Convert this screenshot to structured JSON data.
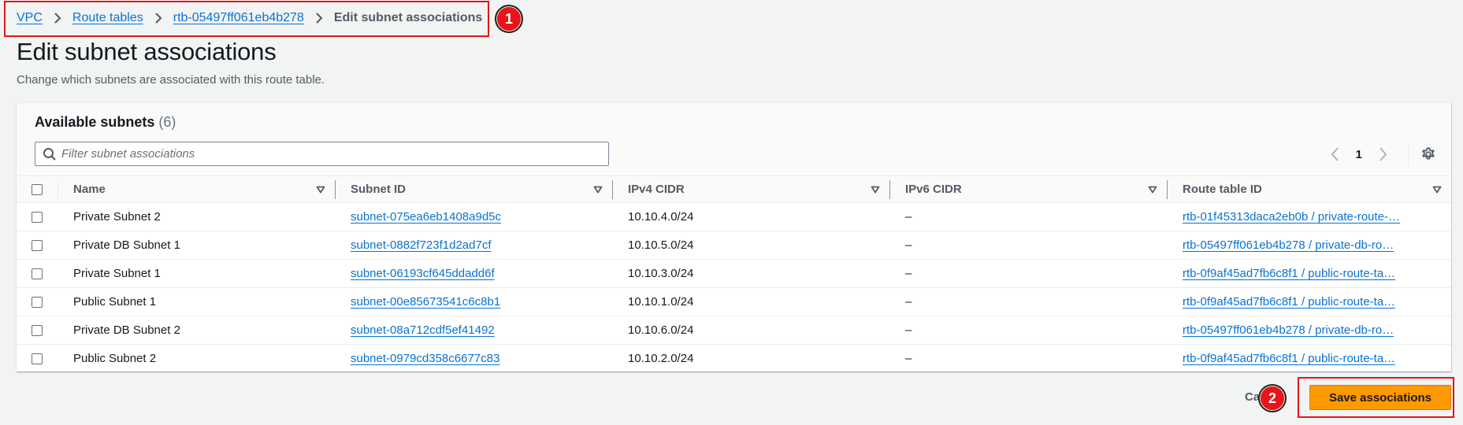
{
  "breadcrumb": {
    "items": [
      {
        "label": "VPC",
        "link": true
      },
      {
        "label": "Route tables",
        "link": true
      },
      {
        "label": "rtb-05497ff061eb4b278",
        "link": true
      },
      {
        "label": "Edit subnet associations",
        "link": false
      }
    ]
  },
  "page": {
    "title": "Edit subnet associations",
    "description": "Change which subnets are associated with this route table."
  },
  "panel": {
    "title": "Available subnets",
    "count": "(6)",
    "filter_placeholder": "Filter subnet associations",
    "filter_value": "",
    "page_number": "1",
    "columns": [
      "Name",
      "Subnet ID",
      "IPv4 CIDR",
      "IPv6 CIDR",
      "Route table ID"
    ],
    "rows": [
      {
        "name": "Private Subnet 2",
        "subnet_id": "subnet-075ea6eb1408a9d5c",
        "ipv4": "10.10.4.0/24",
        "ipv6": "–",
        "route_table": "rtb-01f45313daca2eb0b / private-route-…",
        "checked": false
      },
      {
        "name": "Private DB Subnet 1",
        "subnet_id": "subnet-0882f723f1d2ad7cf",
        "ipv4": "10.10.5.0/24",
        "ipv6": "–",
        "route_table": "rtb-05497ff061eb4b278 / private-db-ro…",
        "checked": false
      },
      {
        "name": "Private Subnet 1",
        "subnet_id": "subnet-06193cf645ddadd6f",
        "ipv4": "10.10.3.0/24",
        "ipv6": "–",
        "route_table": "rtb-0f9af45ad7fb6c8f1 / public-route-ta…",
        "checked": false
      },
      {
        "name": "Public Subnet 1",
        "subnet_id": "subnet-00e85673541c6c8b1",
        "ipv4": "10.10.1.0/24",
        "ipv6": "–",
        "route_table": "rtb-0f9af45ad7fb6c8f1 / public-route-ta…",
        "checked": false
      },
      {
        "name": "Private DB Subnet 2",
        "subnet_id": "subnet-08a712cdf5ef41492",
        "ipv4": "10.10.6.0/24",
        "ipv6": "–",
        "route_table": "rtb-05497ff061eb4b278 / private-db-ro…",
        "checked": false
      },
      {
        "name": "Public Subnet 2",
        "subnet_id": "subnet-0979cd358c6677c83",
        "ipv4": "10.10.2.0/24",
        "ipv6": "–",
        "route_table": "rtb-0f9af45ad7fb6c8f1 / public-route-ta…",
        "checked": false
      }
    ]
  },
  "actions": {
    "cancel_label": "Ca",
    "save_label": "Save associations"
  },
  "annotations": [
    {
      "label": "1"
    },
    {
      "label": "2"
    }
  ],
  "icons": {
    "breadcrumb_separator": "chevron-right-icon",
    "filter": "search-icon",
    "prev_page": "chevron-left-icon",
    "next_page": "chevron-right-icon",
    "settings": "gear-icon",
    "sort": "sort-caret-down-icon"
  },
  "colors": {
    "link": "#0972d3",
    "primary_button": "#ff9900",
    "annotation": "#e8141a",
    "background": "#f2f3f3"
  }
}
